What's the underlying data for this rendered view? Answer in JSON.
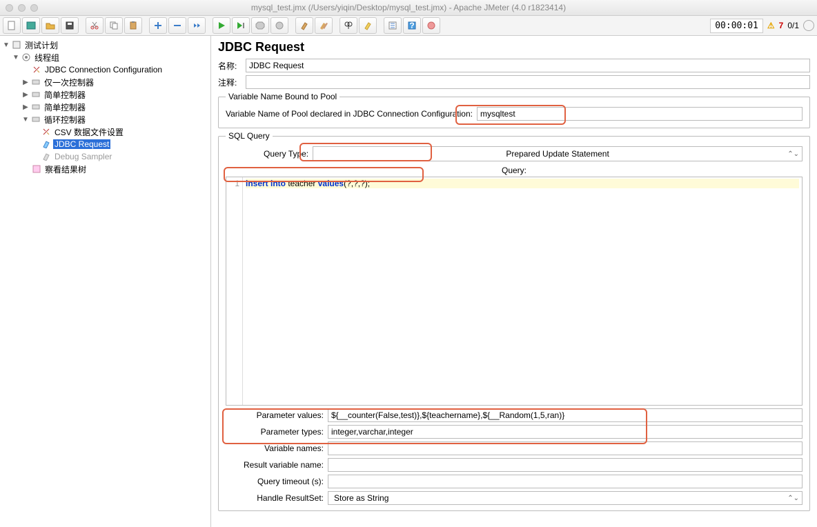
{
  "window": {
    "title": "mysql_test.jmx (/Users/yiqin/Desktop/mysql_test.jmx) - Apache JMeter (4.0 r1823414)"
  },
  "toolbar": {
    "timer": "00:00:01",
    "warn_count": "7",
    "thread_count": "0/1"
  },
  "tree": {
    "root": "测试计划",
    "threadgroup": "线程组",
    "items": [
      "JDBC Connection Configuration",
      "仅一次控制器",
      "简单控制器",
      "简单控制器",
      "循环控制器",
      "CSV 数据文件设置",
      "JDBC Request",
      "Debug Sampler",
      "察看结果树"
    ]
  },
  "panel": {
    "title": "JDBC Request",
    "name_label": "名称:",
    "name_value": "JDBC Request",
    "comment_label": "注释:",
    "comment_value": "",
    "pool_fieldset": "Variable Name Bound to Pool",
    "pool_label": "Variable Name of Pool declared in JDBC Connection Configuration:",
    "pool_value": "mysqltest",
    "sqlquery_fieldset": "SQL Query",
    "query_type_label": "Query Type:",
    "query_type_value": "Prepared Update Statement",
    "query_label": "Query:",
    "code_line_number": "1",
    "code_kw1": "insert into",
    "code_id": " teacher ",
    "code_kw2": "values",
    "code_rest": "(?,?,?);",
    "param_values_label": "Parameter values:",
    "param_values": "${__counter(False,test)},${teachername},${__Random(1,5,ran)}",
    "param_types_label": "Parameter types:",
    "param_types": "integer,varchar,integer",
    "var_names_label": "Variable names:",
    "var_names": "",
    "result_var_label": "Result variable name:",
    "result_var": "",
    "timeout_label": "Query timeout (s):",
    "timeout": "",
    "handle_label": "Handle ResultSet:",
    "handle_value": "Store as String"
  }
}
